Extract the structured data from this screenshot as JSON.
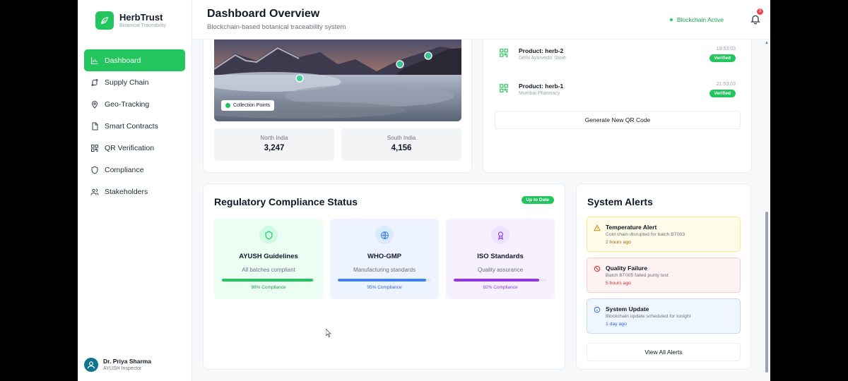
{
  "brand": {
    "name": "HerbTrust",
    "subtitle": "Botanical Traceability"
  },
  "nav": [
    {
      "label": "Dashboard",
      "icon": "chart-icon",
      "active": true
    },
    {
      "label": "Supply Chain",
      "icon": "route-icon"
    },
    {
      "label": "Geo-Tracking",
      "icon": "map-pin-icon"
    },
    {
      "label": "Smart Contracts",
      "icon": "file-icon"
    },
    {
      "label": "QR Verification",
      "icon": "qr-icon"
    },
    {
      "label": "Compliance",
      "icon": "shield-icon"
    },
    {
      "label": "Stakeholders",
      "icon": "users-icon"
    }
  ],
  "user": {
    "name": "Dr. Priya Sharma",
    "role": "AYUSH Inspector"
  },
  "header": {
    "title": "Dashboard Overview",
    "subtitle": "Blockchain-based botanical traceability system",
    "status": "Blockchain Active",
    "notifications": "3"
  },
  "geo": {
    "badge": "Collection Points",
    "regions": [
      {
        "label": "North India",
        "value": "3,247"
      },
      {
        "label": "South India",
        "value": "4,156"
      }
    ]
  },
  "qr": {
    "items": [
      {
        "product": "Product: herb-2",
        "store": "Delhi Ayurvedic Store",
        "time": "19:53:03",
        "status": "Verified"
      },
      {
        "product": "Product: herb-1",
        "store": "Mumbai Pharmacy",
        "time": "21:53:03",
        "status": "Verified"
      }
    ],
    "button": "Generate New QR Code"
  },
  "compliance": {
    "title": "Regulatory Compliance Status",
    "badge": "Up to Date",
    "items": [
      {
        "name": "AYUSH Guidelines",
        "desc": "All batches compliant",
        "pct": "98% Compliance",
        "value": 0.98,
        "color": "#22c55e",
        "bg": "#ecfdf3",
        "icon": "shield-icon"
      },
      {
        "name": "WHO-GMP",
        "desc": "Manufacturing standards",
        "pct": "95% Compliance",
        "value": 0.95,
        "color": "#3b82f6",
        "bg": "#eef4ff",
        "icon": "globe-icon"
      },
      {
        "name": "ISO Standards",
        "desc": "Quality assurance",
        "pct": "92% Compliance",
        "value": 0.92,
        "color": "#9333ea",
        "bg": "#f6f0ff",
        "icon": "award-icon"
      }
    ]
  },
  "alerts": {
    "title": "System Alerts",
    "items": [
      {
        "title": "Temperature Alert",
        "desc": "Cold chain disrupted for batch BT003",
        "time": "2 hours ago",
        "bg": "#fefce8",
        "border": "#fde68a",
        "timeColor": "#a16207",
        "icon": "warning-icon"
      },
      {
        "title": "Quality Failure",
        "desc": "Batch BT005 failed purity test",
        "time": "5 hours ago",
        "bg": "#fef2f2",
        "border": "#fecaca",
        "timeColor": "#dc2626",
        "icon": "ban-icon"
      },
      {
        "title": "System Update",
        "desc": "Blockchain update scheduled for tonight",
        "time": "1 day ago",
        "bg": "#eff6ff",
        "border": "#bfdbfe",
        "timeColor": "#2563eb",
        "icon": "info-icon"
      }
    ],
    "button": "View All Alerts"
  }
}
